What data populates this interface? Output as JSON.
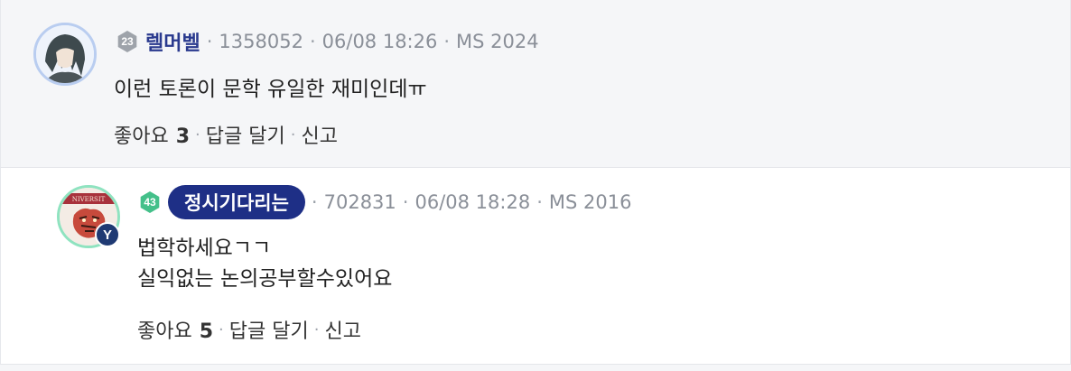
{
  "comments": [
    {
      "level": "23",
      "nickname": "렐머벨",
      "user_id": "1358052",
      "timestamp": "06/08 18:26",
      "affiliation": "MS 2024",
      "text_lines": [
        "이런 토론이 문학 유일한 재미인데ㅠ"
      ],
      "like_label": "좋아요",
      "like_count": "3",
      "reply_label": "답글 달기",
      "report_label": "신고"
    },
    {
      "level": "43",
      "nickname": "정시기다리는",
      "user_id": "702831",
      "timestamp": "06/08 18:28",
      "affiliation": "MS 2016",
      "school_badge": "Y",
      "text_lines": [
        "법학하세요ㄱㄱ",
        "실익없는 논의공부할수있어요"
      ],
      "like_label": "좋아요",
      "like_count": "5",
      "reply_label": "답글 달기",
      "report_label": "신고"
    }
  ],
  "separator": "·",
  "colors": {
    "nickname_blue": "#2a3a8e",
    "pill_navy": "#1e2f86",
    "level_gray": "#9ea3aa",
    "level_green": "#44c08a",
    "meta_gray": "#8a8f98"
  },
  "icons": {
    "level_badge": "hexagon-level-icon",
    "school_badge": "school-badge-icon"
  }
}
